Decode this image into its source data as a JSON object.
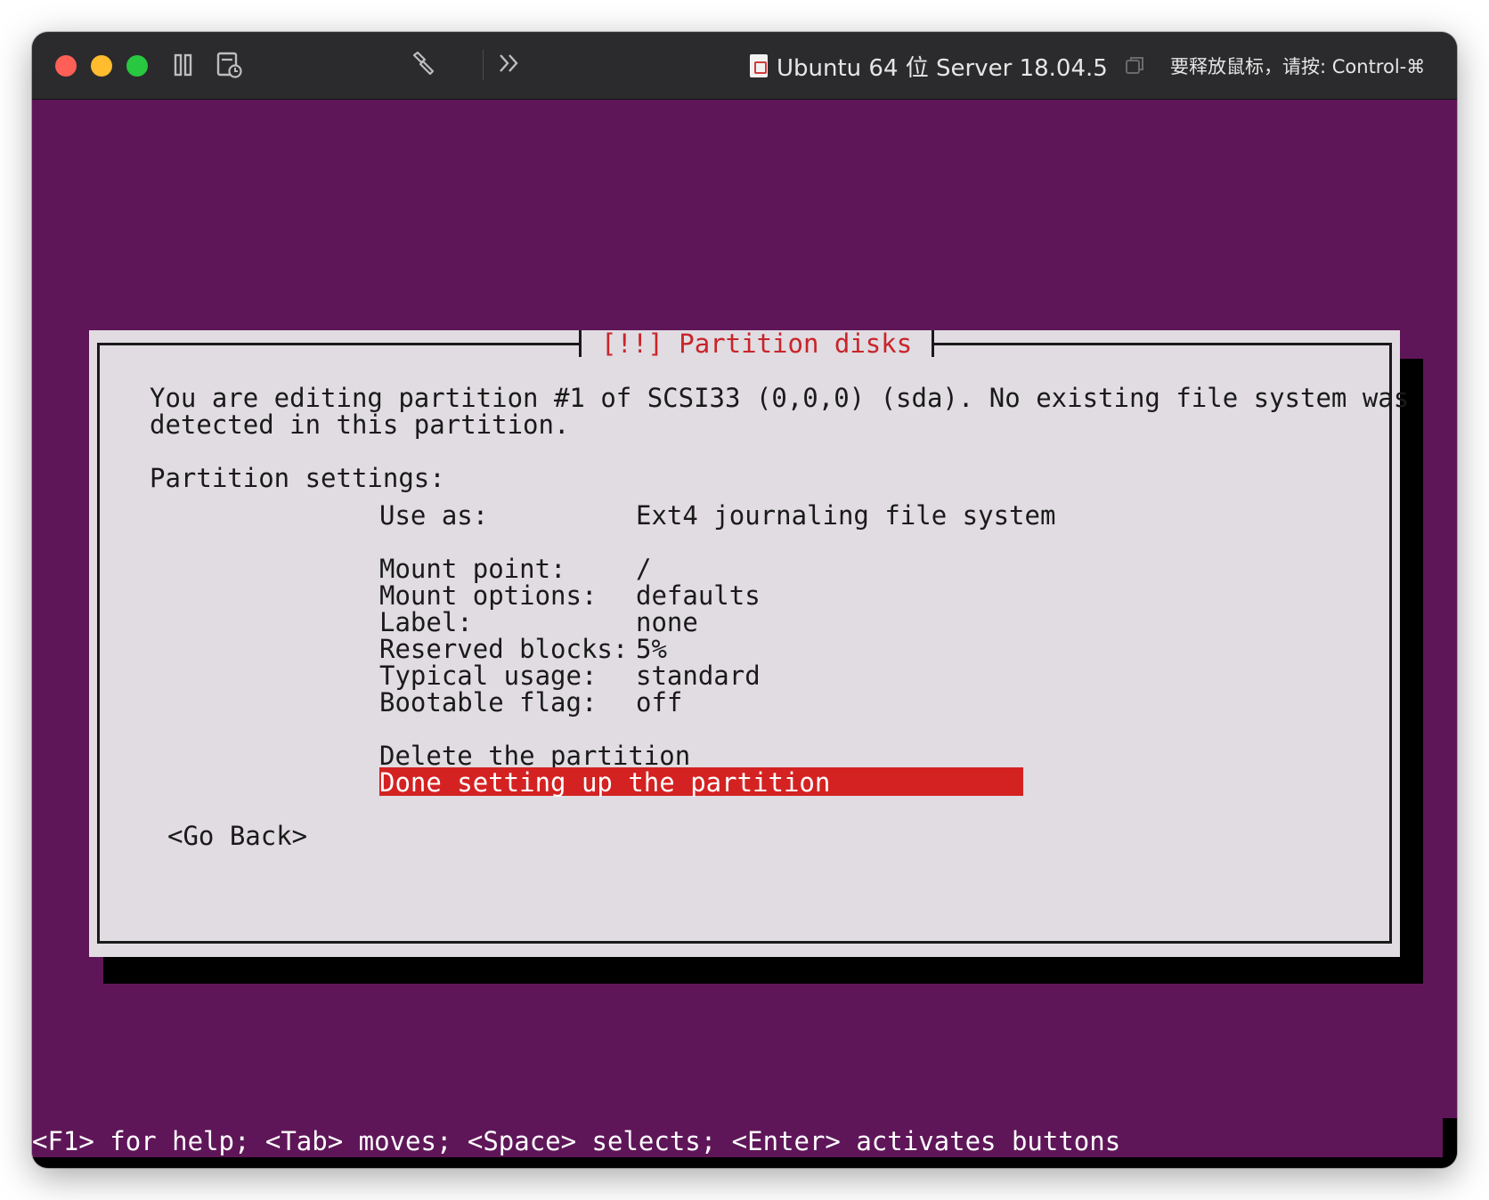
{
  "window": {
    "title": "Ubuntu 64 位 Server 18.04.5",
    "status": "要释放鼠标，请按: Control-⌘"
  },
  "toolbar": {
    "icons": [
      "close-icon",
      "minimize-icon",
      "zoom-icon",
      "pause-icon",
      "snapshot-icon",
      "settings-wrench-icon",
      "forward-chevron-icon",
      "document-icon",
      "overlay-window-icon"
    ]
  },
  "dialog": {
    "title": "[!!] Partition disks",
    "intro_line1": "You are editing partition #1 of SCSI33 (0,0,0) (sda). No existing file system was",
    "intro_line2": "detected in this partition.",
    "settings_heading": "Partition settings:",
    "settings": [
      {
        "label": "Use as:",
        "value": "Ext4 journaling file system"
      },
      {
        "label": "Mount point:",
        "value": "/"
      },
      {
        "label": "Mount options:",
        "value": "defaults"
      },
      {
        "label": "Label:",
        "value": "none"
      },
      {
        "label": "Reserved blocks:",
        "value": "5%"
      },
      {
        "label": "Typical usage:",
        "value": "standard"
      },
      {
        "label": "Bootable flag:",
        "value": "off"
      }
    ],
    "actions": {
      "delete": "Delete the partition",
      "done": "Done setting up the partition"
    },
    "go_back": "<Go Back>"
  },
  "footer": {
    "help": "<F1> for help; <Tab> moves; <Space> selects; <Enter> activates buttons"
  },
  "colors": {
    "background": "#5f1659",
    "dialog": "#e0dce1",
    "title_red": "#c8242a",
    "selection": "#d42222"
  }
}
